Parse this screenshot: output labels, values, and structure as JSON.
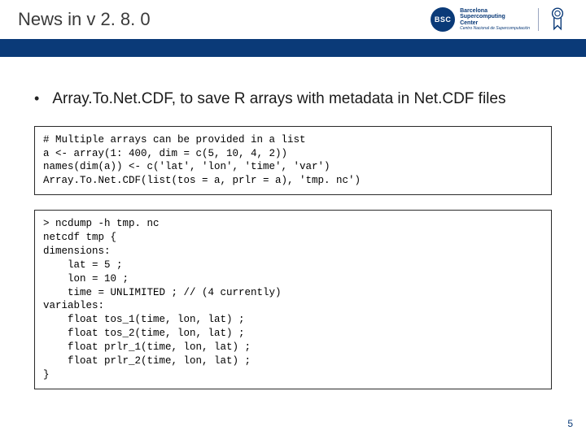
{
  "header": {
    "title": "News in v 2. 8. 0",
    "logo_abbr": "BSC",
    "logo_line1": "Barcelona",
    "logo_line2": "Supercomputing",
    "logo_line3": "Center",
    "logo_sub": "Centro Nacional de Supercomputación"
  },
  "bullet": {
    "text": "Array.To.Net.CDF, to save R arrays with metadata in Net.CDF files"
  },
  "code1": "# Multiple arrays can be provided in a list\na <- array(1: 400, dim = c(5, 10, 4, 2))\nnames(dim(a)) <- c('lat', 'lon', 'time', 'var')\nArray.To.Net.CDF(list(tos = a, prlr = a), 'tmp. nc')",
  "code2": "> ncdump -h tmp. nc\nnetcdf tmp {\ndimensions:\n    lat = 5 ;\n    lon = 10 ;\n    time = UNLIMITED ; // (4 currently)\nvariables:\n    float tos_1(time, lon, lat) ;\n    float tos_2(time, lon, lat) ;\n    float prlr_1(time, lon, lat) ;\n    float prlr_2(time, lon, lat) ;\n}",
  "page_number": "5"
}
